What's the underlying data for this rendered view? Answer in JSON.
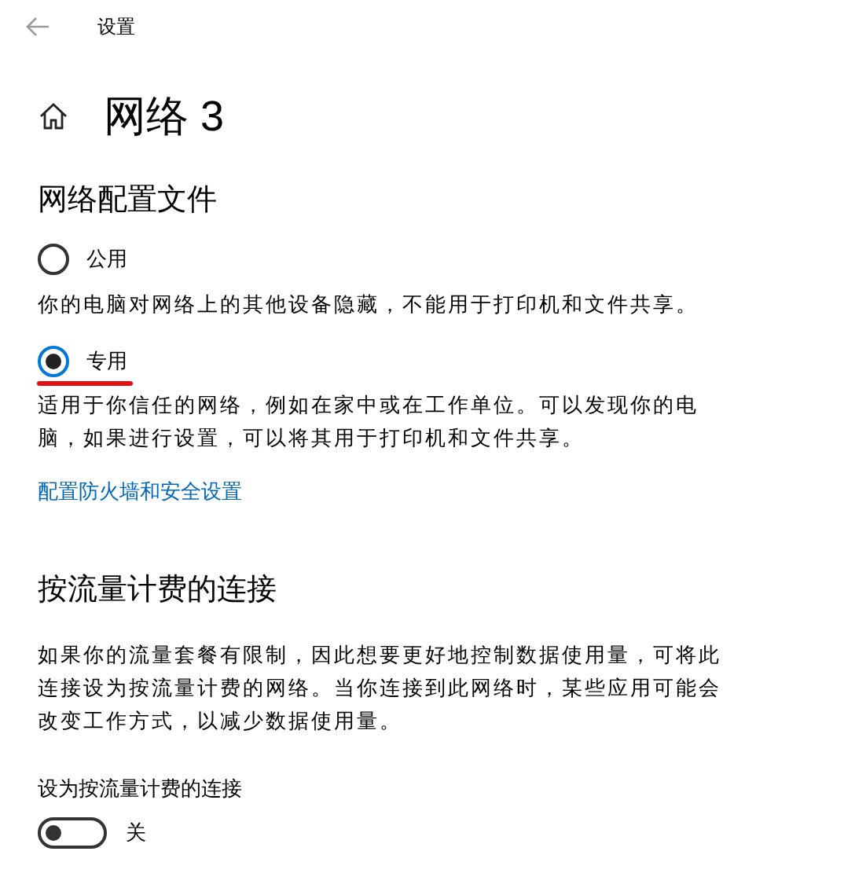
{
  "window": {
    "title": "设置"
  },
  "page": {
    "title": "网络 3"
  },
  "profile": {
    "heading": "网络配置文件",
    "options": [
      {
        "label": "公用",
        "selected": false,
        "description": "你的电脑对网络上的其他设备隐藏，不能用于打印机和文件共享。",
        "underlined": false
      },
      {
        "label": "专用",
        "selected": true,
        "description": "适用于你信任的网络，例如在家中或在工作单位。可以发现你的电脑，如果进行设置，可以将其用于打印机和文件共享。",
        "underlined": true
      }
    ],
    "link": "配置防火墙和安全设置"
  },
  "metered": {
    "heading": "按流量计费的连接",
    "description": "如果你的流量套餐有限制，因此想要更好地控制数据使用量，可将此连接设为按流量计费的网络。当你连接到此网络时，某些应用可能会改变工作方式，以减少数据使用量。",
    "toggle_label": "设为按流量计费的连接",
    "on": false,
    "state_text": "关"
  }
}
